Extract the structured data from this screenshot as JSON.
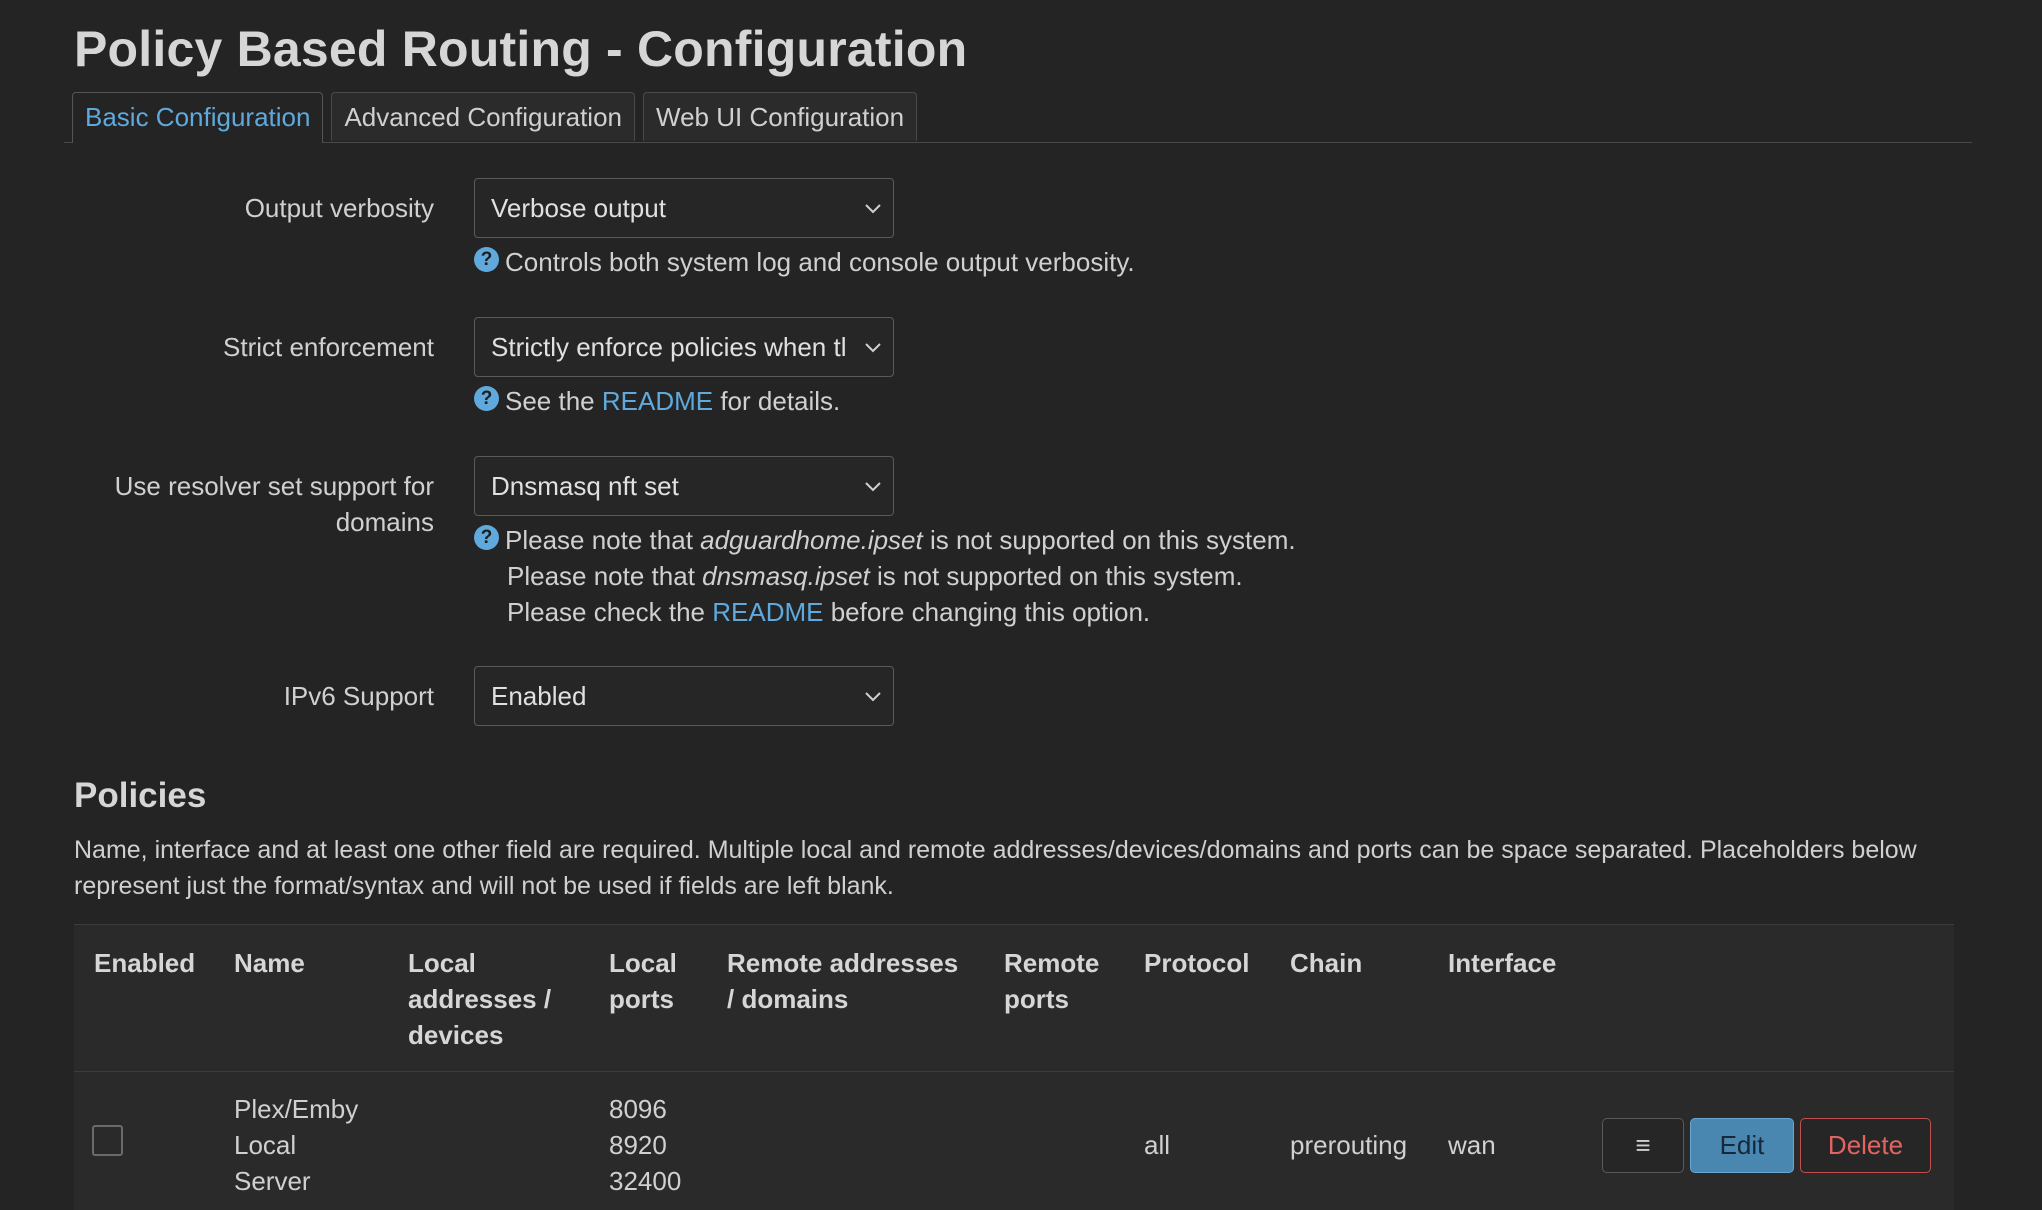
{
  "page": {
    "title": "Policy Based Routing - Configuration"
  },
  "tabs": [
    {
      "label": "Basic Configuration",
      "active": true
    },
    {
      "label": "Advanced Configuration",
      "active": false
    },
    {
      "label": "Web UI Configuration",
      "active": false
    }
  ],
  "settings": {
    "verbosity": {
      "label": "Output verbosity",
      "value": "Verbose output",
      "help": "Controls both system log and console output verbosity."
    },
    "strict": {
      "label": "Strict enforcement",
      "value": "Strictly enforce policies when tl",
      "help_pre": "See the ",
      "help_link": "README",
      "help_post": " for details."
    },
    "resolver": {
      "label": "Use resolver set support for domains",
      "value": "Dnsmasq nft set",
      "help1_pre": "Please note that ",
      "help1_em": "adguardhome.ipset",
      "help1_post": " is not supported on this system.",
      "help2_pre": "Please note that ",
      "help2_em": "dnsmasq.ipset",
      "help2_post": " is not supported on this system.",
      "help3_pre": "Please check the ",
      "help3_link": "README",
      "help3_post": " before changing this option."
    },
    "ipv6": {
      "label": "IPv6 Support",
      "value": "Enabled"
    }
  },
  "policies": {
    "title": "Policies",
    "description": "Name, interface and at least one other field are required. Multiple local and remote addresses/devices/domains and ports can be space separated. Placeholders below represent just the format/syntax and will not be used if fields are left blank.",
    "columns": {
      "enabled": "Enabled",
      "name": "Name",
      "local_addr_1": "Local",
      "local_addr_2": "addresses /",
      "local_addr_3": "devices",
      "local_ports_1": "Local",
      "local_ports_2": "ports",
      "remote_addr_1": "Remote addresses",
      "remote_addr_2": "/ domains",
      "remote_ports_1": "Remote",
      "remote_ports_2": "ports",
      "protocol": "Protocol",
      "chain": "Chain",
      "interface": "Interface"
    },
    "rows": [
      {
        "enabled": false,
        "name_1": "Plex/Emby",
        "name_2": "Local",
        "name_3": "Server",
        "local_addresses": "",
        "port_1": "8096",
        "port_2": "8920",
        "port_3": "32400",
        "remote_addresses": "",
        "remote_ports": "",
        "protocol": "all",
        "chain": "prerouting",
        "interface": "wan"
      }
    ],
    "buttons": {
      "menu": "≡",
      "edit": "Edit",
      "delete": "Delete"
    }
  }
}
